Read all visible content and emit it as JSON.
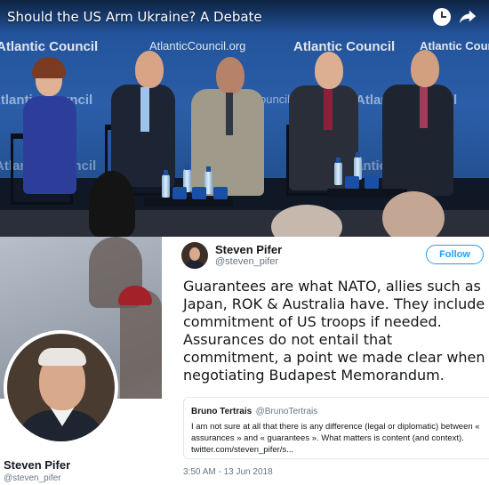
{
  "video": {
    "title": "Should the US Arm Ukraine? A Debate",
    "backdrop_logo_text": "Atlantic Council",
    "backdrop_url_text": "AtlanticCouncil.org",
    "icons": [
      "clock-icon",
      "share-icon"
    ]
  },
  "profile": {
    "name": "Steven Pifer",
    "handle": "@steven_pifer"
  },
  "tweet": {
    "author_name": "Steven Pifer",
    "author_handle": "@steven_pifer",
    "follow_label": "Follow",
    "text": "Guarantees are what NATO, allies such as Japan, ROK & Australia have. They include commitment of US troops if needed. Assurances do not entail that commitment, a point we made clear when negotiating Budapest Memorandum.",
    "quoted": {
      "author_name": "Bruno Tertrais",
      "author_handle": "@BrunoTertrais",
      "text": "I am not sure at all that there is any difference (legal or diplomatic) between « assurances » and « guarantees ». What matters is content (and context). twitter.com/steven_pifer/s..."
    },
    "timestamp": "3:50 AM - 13 Jun 2018"
  },
  "colors": {
    "backdrop_blue": "#2b5ea8",
    "twitter_blue": "#1da1f2",
    "muted_gray": "#657786"
  }
}
